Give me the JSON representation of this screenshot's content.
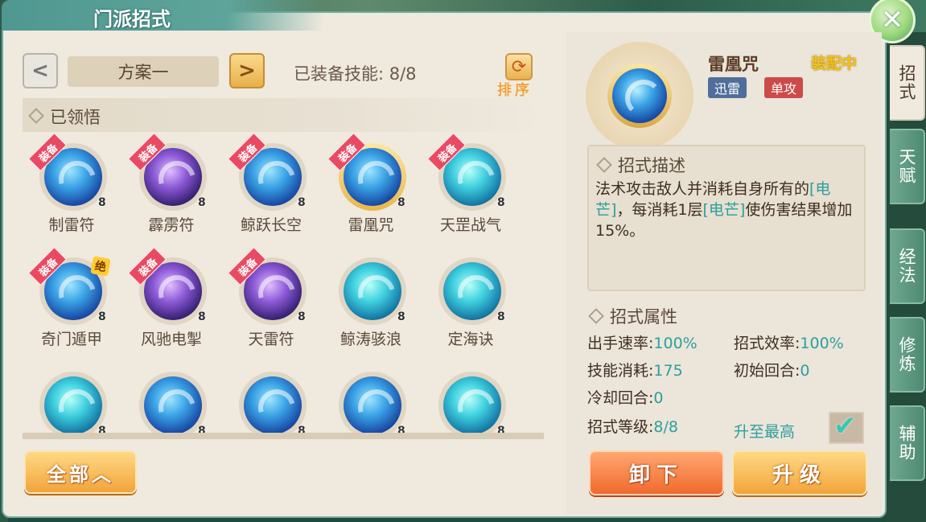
{
  "window": {
    "title": "门派招式",
    "close_glyph": "✕"
  },
  "left": {
    "prev_glyph": "<",
    "next_glyph": ">",
    "scheme_label": "方案一",
    "equipped_label": "已装备技能: 8/8",
    "sort_label": "排序",
    "sort_glyph": "⟳",
    "learned_label": "已领悟",
    "all_button": "全部︿",
    "skills": [
      {
        "name": "制雷符",
        "level": "8",
        "badge": "装备",
        "selected": false
      },
      {
        "name": "霹雳符",
        "level": "8",
        "badge": "装备",
        "selected": false
      },
      {
        "name": "鲸跃长空",
        "level": "8",
        "badge": "装备",
        "selected": false
      },
      {
        "name": "雷凰咒",
        "level": "8",
        "badge": "装备",
        "selected": true
      },
      {
        "name": "天罡战气",
        "level": "8",
        "badge": "装备",
        "selected": false
      },
      {
        "name": "奇门遁甲",
        "level": "8",
        "badge": "装备",
        "extra_badge": "绝",
        "selected": false
      },
      {
        "name": "风驰电掣",
        "level": "8",
        "badge": "装备",
        "selected": false
      },
      {
        "name": "天雷符",
        "level": "8",
        "badge": "装备",
        "selected": false
      },
      {
        "name": "鲸涛骇浪",
        "level": "8",
        "badge": "",
        "selected": false
      },
      {
        "name": "定海诀",
        "level": "8",
        "badge": "",
        "selected": false
      },
      {
        "name": "",
        "level": "8",
        "badge": "",
        "selected": false
      },
      {
        "name": "",
        "level": "8",
        "badge": "",
        "selected": false
      },
      {
        "name": "",
        "level": "8",
        "badge": "",
        "selected": false
      },
      {
        "name": "",
        "level": "8",
        "badge": "",
        "selected": false
      },
      {
        "name": "",
        "level": "8",
        "badge": "",
        "selected": false
      }
    ]
  },
  "detail": {
    "name": "雷凰咒",
    "status": "装配中",
    "tags": [
      "迅雷",
      "单攻"
    ],
    "desc_title": "招式描述",
    "desc_parts": [
      {
        "text": "法术攻击敌人并消耗自身所有的",
        "hl": false
      },
      {
        "text": "[电芒]",
        "hl": true
      },
      {
        "text": "，每消耗1层",
        "hl": false
      },
      {
        "text": "[电芒]",
        "hl": true
      },
      {
        "text": "使伤害结果增加15%。",
        "hl": false
      }
    ],
    "attr_title": "招式属性",
    "attributes": {
      "speed_label": "出手速率:",
      "speed_value": "100%",
      "efficiency_label": "招式效率:",
      "efficiency_value": "100%",
      "cost_label": "技能消耗:",
      "cost_value": "175",
      "start_label": "初始回合:",
      "start_value": "0",
      "cooldown_label": "冷却回合:",
      "cooldown_value": "0",
      "level_label": "招式等级:",
      "level_value": "8/8"
    },
    "max_label": "升至最高",
    "max_checked": true,
    "unload_button": "卸下",
    "upgrade_button": "升级"
  },
  "side_tabs": [
    "招式",
    "天赋",
    "经法",
    "修炼",
    "辅助"
  ]
}
